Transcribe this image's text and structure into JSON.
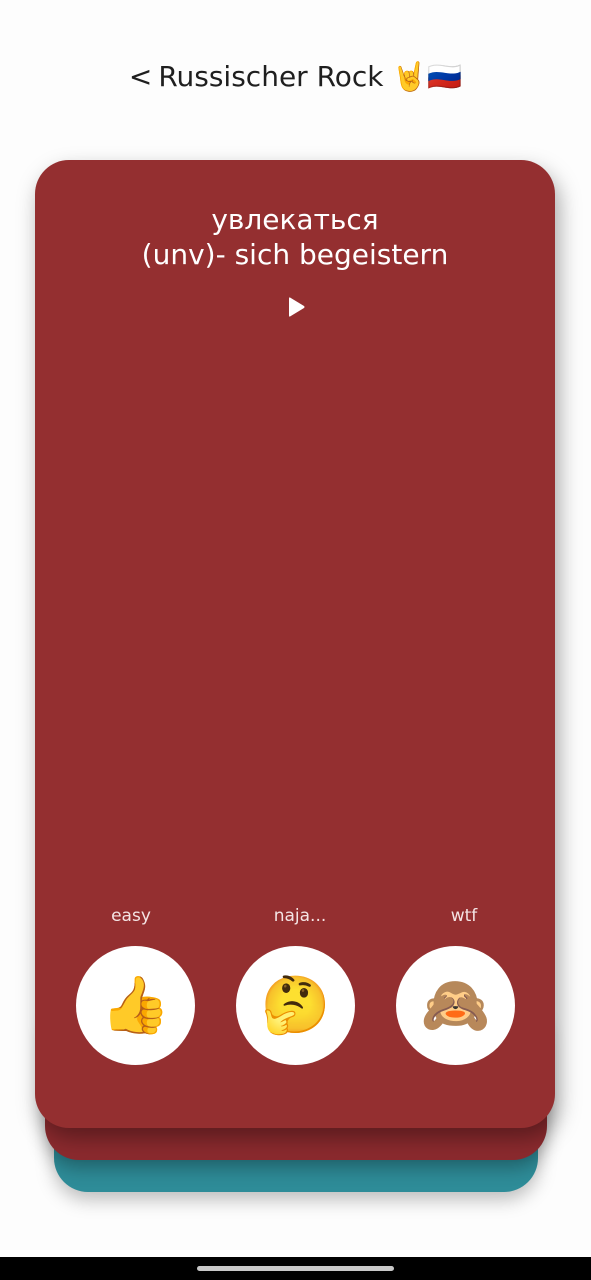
{
  "header": {
    "back_label": "<",
    "title": "Russischer Rock 🤘🇷🇺"
  },
  "card": {
    "word": "увлекаться",
    "translation": "(unv)- sich begeistern",
    "play_icon": "play-icon",
    "colors": {
      "front": "#942f30",
      "back1": "#8b2a2e",
      "back2": "#2e8c98"
    }
  },
  "choices": [
    {
      "label": "easy",
      "emoji": "👍"
    },
    {
      "label": "naja...",
      "emoji": "🤔"
    },
    {
      "label": "wtf",
      "emoji": "🙈"
    }
  ]
}
